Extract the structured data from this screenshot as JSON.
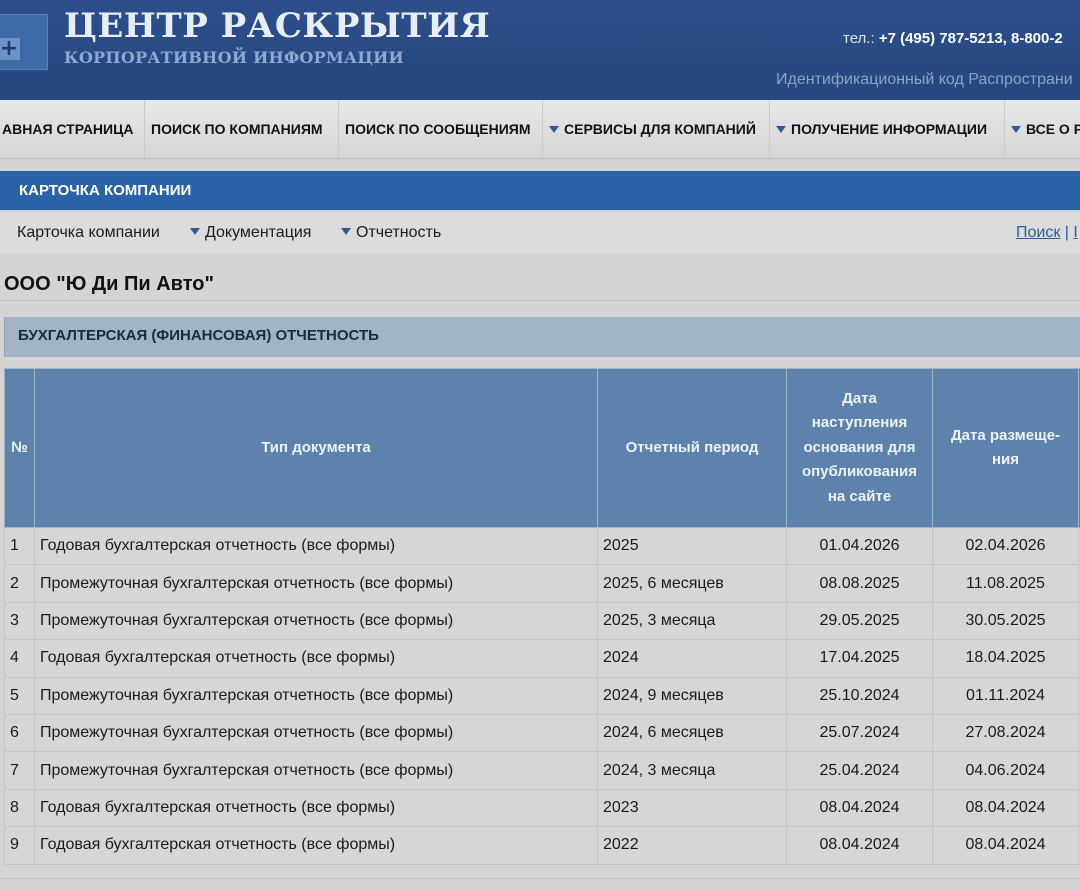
{
  "header": {
    "title": "ЦЕНТР РАСКРЫТИЯ",
    "subtitle": "КОРПОРАТИВНОЙ ИНФОРМАЦИИ",
    "phone_prefix": "тел.: ",
    "phone": "+7 (495) 787-5213, 8-800-2",
    "ident": "Идентификационный код Распространи"
  },
  "main_nav": [
    {
      "label": "АВНАЯ СТРАНИЦА",
      "dropdown": false
    },
    {
      "label": "ПОИСК ПО КОМПАНИЯМ",
      "dropdown": false
    },
    {
      "label": "ПОИСК ПО СООБЩЕНИЯМ",
      "dropdown": false
    },
    {
      "label": "СЕРВИСЫ ДЛЯ КОМПАНИЙ",
      "dropdown": true
    },
    {
      "label": "ПОЛУЧЕНИЕ ИНФОРМАЦИИ",
      "dropdown": true
    },
    {
      "label": "ВСЕ О Р",
      "dropdown": true
    }
  ],
  "card_bar": {
    "label": "КАРТОЧКА КОМПАНИИ"
  },
  "sub_nav": {
    "items": [
      {
        "label": "Карточка компании",
        "dropdown": false
      },
      {
        "label": "Документация",
        "dropdown": true
      },
      {
        "label": "Отчетность",
        "dropdown": true
      }
    ],
    "search_link": "Поиск",
    "separator": " | ",
    "cut_link": "І"
  },
  "company_name": "ООО \"Ю Ди Пи Авто\"",
  "section_title": "БУХГАЛТЕРСКАЯ (ФИНАНСОВАЯ) ОТЧЕТНОСТЬ",
  "table": {
    "headers": {
      "num": "№",
      "doc_type": "Тип документа",
      "period": "Отчетный период",
      "basis_date": "Дата наступления основания для опубликования на сайте",
      "post_date": "Дата размеще-ния"
    },
    "rows": [
      {
        "num": "1",
        "doc_type": "Годовая бухгалтерская отчетность (все формы)",
        "period": "2025",
        "basis_date": "01.04.2026",
        "post_date": "02.04.2026"
      },
      {
        "num": "2",
        "doc_type": "Промежуточная бухгалтерская отчетность (все формы)",
        "period": "2025, 6 месяцев",
        "basis_date": "08.08.2025",
        "post_date": "11.08.2025"
      },
      {
        "num": "3",
        "doc_type": "Промежуточная бухгалтерская отчетность (все формы)",
        "period": "2025, 3 месяца",
        "basis_date": "29.05.2025",
        "post_date": "30.05.2025"
      },
      {
        "num": "4",
        "doc_type": "Годовая бухгалтерская отчетность (все формы)",
        "period": "2024",
        "basis_date": "17.04.2025",
        "post_date": "18.04.2025"
      },
      {
        "num": "5",
        "doc_type": "Промежуточная бухгалтерская отчетность (все формы)",
        "period": "2024, 9 месяцев",
        "basis_date": "25.10.2024",
        "post_date": "01.11.2024"
      },
      {
        "num": "6",
        "doc_type": "Промежуточная бухгалтерская отчетность (все формы)",
        "period": "2024, 6 месяцев",
        "basis_date": "25.07.2024",
        "post_date": "27.08.2024"
      },
      {
        "num": "7",
        "doc_type": "Промежуточная бухгалтерская отчетность (все формы)",
        "period": "2024, 3 месяца",
        "basis_date": "25.04.2024",
        "post_date": "04.06.2024"
      },
      {
        "num": "8",
        "doc_type": "Годовая бухгалтерская отчетность (все формы)",
        "period": "2023",
        "basis_date": "08.04.2024",
        "post_date": "08.04.2024"
      },
      {
        "num": "9",
        "doc_type": "Годовая бухгалтерская отчетность (все формы)",
        "period": "2022",
        "basis_date": "08.04.2024",
        "post_date": "08.04.2024"
      }
    ]
  }
}
